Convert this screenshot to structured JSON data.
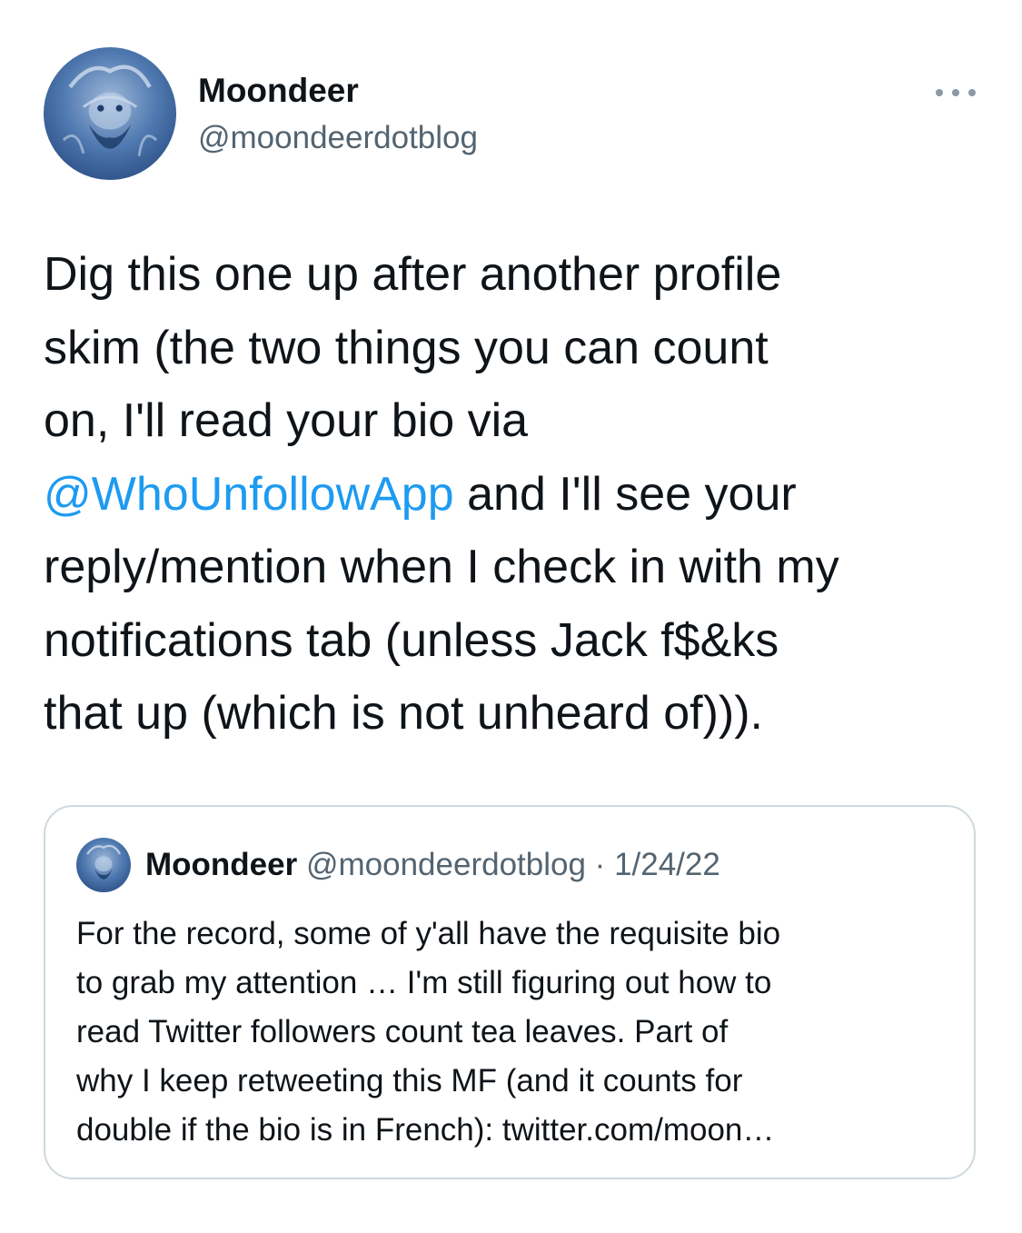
{
  "author": {
    "name": "Moondeer",
    "handle": "@moondeerdotblog"
  },
  "tweet": {
    "lines": [
      "Dig this one up after another profile",
      "skim (the two things you can count",
      "on, I'll read your bio via"
    ],
    "mention": "@WhoUnfollowApp",
    "mention_after": " and I'll see your",
    "lines_after": [
      "reply/mention when I check in with my",
      "notifications tab (unless Jack f$&ks",
      "that up (which is not unheard of)))."
    ]
  },
  "quote": {
    "name": "Moondeer",
    "handle": "@moondeerdotblog",
    "separator": "·",
    "date": "1/24/22",
    "lines": [
      "For the record, some of y'all have the requisite bio",
      "to grab my attention … I'm still figuring out how to",
      "read Twitter followers count tea leaves. Part of",
      "why I keep retweeting this MF (and it counts for",
      "double if the bio is in French): twitter.com/moon…"
    ]
  },
  "icons": {
    "more": "more-horizontal-icon"
  },
  "colors": {
    "text": "#0f1419",
    "secondary": "#536471",
    "link": "#1d9bf0",
    "border": "#cfd9de"
  }
}
